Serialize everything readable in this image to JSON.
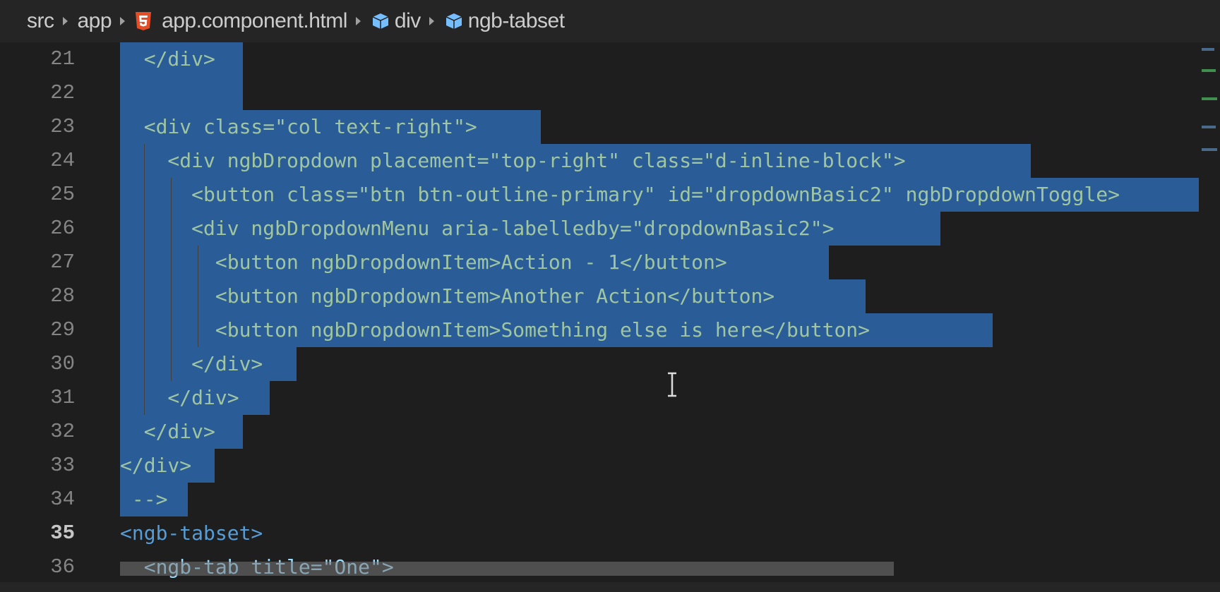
{
  "breadcrumb": {
    "items": [
      "src",
      "app",
      "app.component.html",
      "div",
      "ngb-tabset"
    ]
  },
  "editor": {
    "line_numbers": [
      "21",
      "22",
      "23",
      "24",
      "25",
      "26",
      "27",
      "28",
      "29",
      "30",
      "31",
      "32",
      "33",
      "34",
      "35",
      "36"
    ],
    "active_line": "35",
    "lines": [
      "  </div>",
      "",
      "  <div class=\"col text-right\">",
      "    <div ngbDropdown placement=\"top-right\" class=\"d-inline-block\">",
      "      <button class=\"btn btn-outline-primary\" id=\"dropdownBasic2\" ngbDropdownToggle>",
      "      <div ngbDropdownMenu aria-labelledby=\"dropdownBasic2\">",
      "        <button ngbDropdownItem>Action - 1</button>",
      "        <button ngbDropdownItem>Another Action</button>",
      "        <button ngbDropdownItem>Something else is here</button>",
      "      </div>",
      "    </div>",
      "  </div>",
      "</div>",
      " -->",
      "<ngb-tabset>",
      "  <ngb-tab title=\"One\">"
    ]
  },
  "colors": {
    "background": "#1e1e1e",
    "selection": "#2a5c98",
    "tag": "#569cd6",
    "attribute": "#9cdcfe",
    "string": "#ce9178"
  },
  "icons": [
    "html5-icon",
    "cube-icon",
    "chevron-right-icon",
    "text-cursor-icon"
  ]
}
